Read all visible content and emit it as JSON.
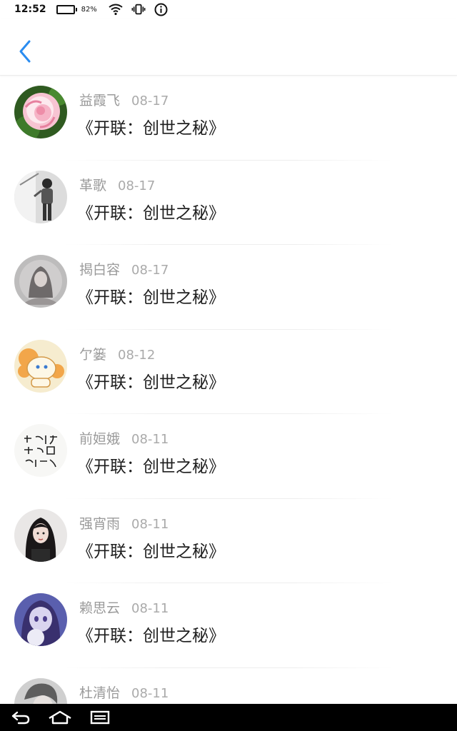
{
  "status_bar": {
    "time": "12:52",
    "battery_percent": "82%",
    "battery_level": 0.82
  },
  "header": {
    "back_icon": "chevron-left-icon",
    "accent_color": "#2a8cf0"
  },
  "items": [
    {
      "name": "益霞飞",
      "date": "08-17",
      "title": "《开联：创世之秘》",
      "avatar": "rose-flower-avatar"
    },
    {
      "name": "革歌",
      "date": "08-17",
      "title": "《开联：创世之秘》",
      "avatar": "monochrome-person-avatar"
    },
    {
      "name": "揭白容",
      "date": "08-17",
      "title": "《开联：创世之秘》",
      "avatar": "misty-girl-avatar"
    },
    {
      "name": "亇篓",
      "date": "08-12",
      "title": "《开联：创世之秘》",
      "avatar": "cartoon-pony-avatar"
    },
    {
      "name": "前姮娥",
      "date": "08-11",
      "title": "《开联：创世之秘》",
      "avatar": "calligraphy-avatar"
    },
    {
      "name": "强宵雨",
      "date": "08-11",
      "title": "《开联：创世之秘》",
      "avatar": "dark-hair-girl-avatar"
    },
    {
      "name": "赖思云",
      "date": "08-11",
      "title": "《开联：创世之秘》",
      "avatar": "anime-girl-avatar"
    },
    {
      "name": "杜清怡",
      "date": "08-11",
      "title": "",
      "avatar": "grey-person-avatar"
    }
  ],
  "nav_bar": {
    "back_icon": "back-arrow-icon",
    "home_icon": "home-icon",
    "recents_icon": "recents-icon"
  }
}
